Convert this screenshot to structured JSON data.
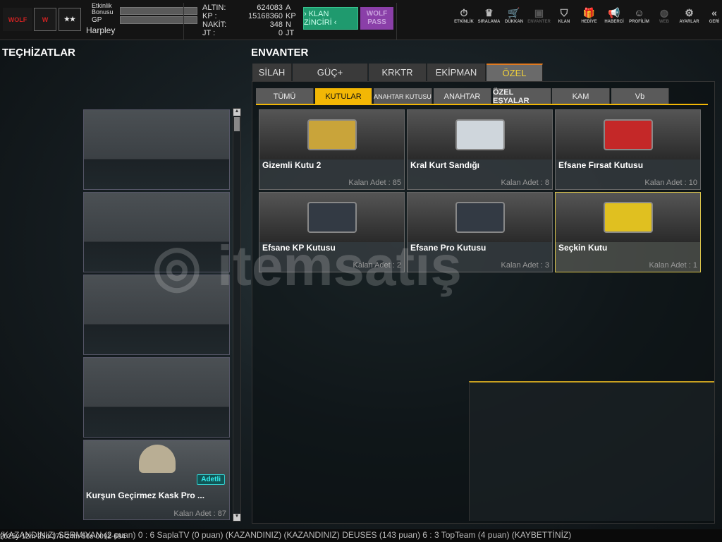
{
  "header": {
    "logo_text": "WOLF",
    "event_bonus_label": "Etkinlik Bonusu",
    "gp_label": "GP",
    "username": "Harpley",
    "currency": [
      {
        "label": "ALTIN:",
        "value": "624083",
        "unit": "A"
      },
      {
        "label": "KP :",
        "value": "15168360",
        "unit": "KP"
      },
      {
        "label": "NAKİT:",
        "value": "348",
        "unit": "N"
      },
      {
        "label": "JT :",
        "value": "0",
        "unit": "JT"
      }
    ],
    "klan_button": "› KLAN ZİNCİRİ ‹",
    "wolf_pass": "WOLF PASS",
    "nav": [
      {
        "label": "ETKİNLİK",
        "icon": "⏱"
      },
      {
        "label": "SIRALAMA",
        "icon": "♛"
      },
      {
        "label": "DÜKKAN",
        "icon": "🛒"
      },
      {
        "label": "ENVANTER",
        "icon": "▣"
      },
      {
        "label": "KLAN",
        "icon": "⛉"
      },
      {
        "label": "HEDİYE",
        "icon": "🎁"
      },
      {
        "label": "HABERCİ",
        "icon": "📢"
      },
      {
        "label": "PROFİLİM",
        "icon": "☺"
      },
      {
        "label": "WEB",
        "icon": "◍"
      },
      {
        "label": "AYARLAR",
        "icon": "⚙"
      },
      {
        "label": "GERİ",
        "icon": "«"
      }
    ]
  },
  "left": {
    "title": "TEÇHİZATLAR",
    "item": {
      "name": "Kurşun Geçirmez Kask Pro ...",
      "badge": "Adetli",
      "qty": "Kalan Adet : 87"
    }
  },
  "inventory": {
    "title": "ENVANTER",
    "tabs": [
      "SİLAH",
      "GÜÇ+",
      "KRKTR",
      "EKİPMAN",
      "ÖZEL"
    ],
    "subtabs": [
      "TÜMÜ",
      "KUTULAR",
      "ANAHTAR KUTUSU",
      "ANAHTAR",
      "ÖZEL EŞYALAR",
      "KAM",
      "Vb"
    ],
    "items": [
      {
        "name": "Gizemli Kutu 2",
        "qty": "Kalan Adet : 85",
        "color": "#c9a43a"
      },
      {
        "name": "Kral Kurt Sandığı",
        "qty": "Kalan Adet : 8",
        "color": "#cfd6dc"
      },
      {
        "name": "Efsane Fırsat Kutusu",
        "qty": "Kalan Adet : 10",
        "color": "#c42828"
      },
      {
        "name": "Efsane KP Kutusu",
        "qty": "Kalan Adet : 2",
        "color": "#333a44"
      },
      {
        "name": "Efsane Pro Kutusu",
        "qty": "Kalan Adet : 3",
        "color": "#333a44"
      },
      {
        "name": "Seçkin Kutu",
        "qty": "Kalan Adet : 1",
        "color": "#e0c020"
      }
    ]
  },
  "ticker": "(KAZANDINIZ) SERMIYAN (2 puan) 0 : 6 SaplaTV (0 puan) (KAZANDINIZ)          (KAZANDINIZ) DEUSES (143 puan) 6 : 3 TopTeam (4 puan) (KAYBETTİNİZ)",
  "timestamp": "2025y-12m-25d-17h-24m-56s-0092-694"
}
